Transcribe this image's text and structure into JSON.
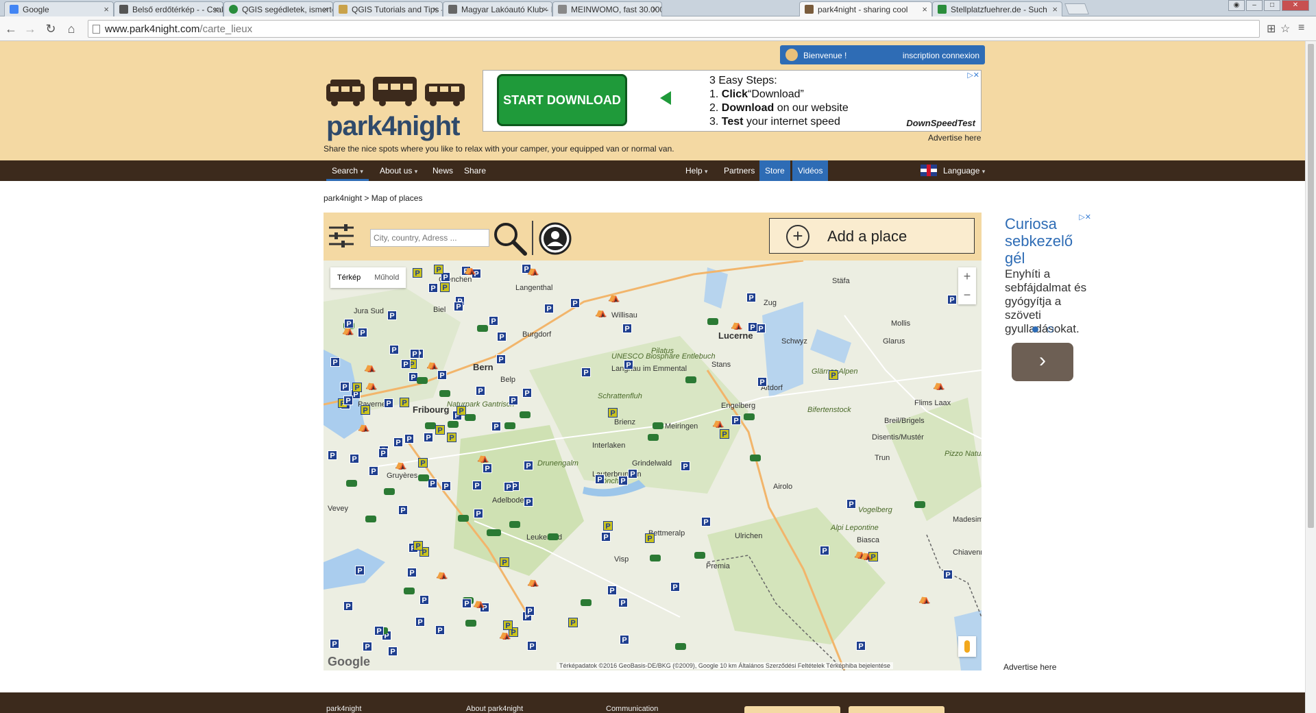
{
  "browser": {
    "tabs": [
      {
        "title": "Google",
        "color": "#4285f4"
      },
      {
        "title": "Belső erdőtérkép - - Csak",
        "color": "#555555"
      },
      {
        "title": "QGIS segédletek, ismertet",
        "color": "#2a8d3c"
      },
      {
        "title": "QGIS Tutorials and Tips —",
        "color": "#c9a24a"
      },
      {
        "title": "Magyar Lakóautó Klub - M",
        "color": "#666666"
      },
      {
        "title": "MEINWOMO, fast 30.000",
        "color": "#888888"
      },
      {
        "title": "park4night - sharing cool",
        "color": "#7a5c3c"
      },
      {
        "title": "Stellplatzfuehrer.de - Such",
        "color": "#2a8d3c"
      }
    ],
    "active_tab": 6,
    "url_host": "www.park4night.com",
    "url_path": "/carte_lieux"
  },
  "header": {
    "welcome": "Bienvenue !",
    "auth": "inscription connexion",
    "logo_text": "park4night",
    "tagline": "Share the nice spots where you like to relax with your camper, your equipped van or normal van.",
    "advertise": "Advertise here"
  },
  "ad_banner": {
    "button": "START DOWNLOAD",
    "steps_title": "3 Easy Steps:",
    "step1_bold": "Click",
    "step1_rest": "“Download”",
    "step2_bold": "Download",
    "step2_rest": "on our website",
    "step3_bold": "Test",
    "step3_rest": "your internet speed",
    "sponsor": "DownSpeedTest"
  },
  "nav": {
    "search": "Search",
    "about": "About us",
    "news": "News",
    "share": "Share",
    "help": "Help",
    "partners": "Partners",
    "store": "Store",
    "videos": "Vidéos",
    "language": "Language"
  },
  "breadcrumb": {
    "home": "park4night",
    "sep": ">",
    "current": "Map of places"
  },
  "search_panel": {
    "placeholder": "City, country, Adress ...",
    "add_place": "Add a place"
  },
  "map": {
    "type_map": "Térkép",
    "type_sat": "Műhold",
    "zoom_in": "+",
    "zoom_out": "−",
    "attribution": "Térképadatok ©2016 GeoBasis-DE/BKG (©2009), Google    10 km    Általános Szerződési Feltételek    Térképhiba bejelentése",
    "google": "Google",
    "labels": [
      {
        "text": "Grenchen"
      },
      {
        "text": "Langenthal"
      },
      {
        "text": "Biel"
      },
      {
        "text": "Willisau"
      },
      {
        "text": "Burgdorf"
      },
      {
        "text": "Bern"
      },
      {
        "text": "Fribourg"
      },
      {
        "text": "Payerne"
      },
      {
        "text": "Zug"
      },
      {
        "text": "Stäfa"
      },
      {
        "text": "Glarus"
      },
      {
        "text": "Mollis"
      },
      {
        "text": "Stans"
      },
      {
        "text": "Altdorf"
      },
      {
        "text": "Engelberg"
      },
      {
        "text": "Meiringen"
      },
      {
        "text": "Brienz"
      },
      {
        "text": "Interlaken"
      },
      {
        "text": "Grindelwald"
      },
      {
        "text": "Lauterbrunnen"
      },
      {
        "text": "Adelboden"
      },
      {
        "text": "Gruyères"
      },
      {
        "text": "Vevey"
      },
      {
        "text": "Leukerbad"
      },
      {
        "text": "Visp"
      },
      {
        "text": "Bettmeralp"
      },
      {
        "text": "Airolo"
      },
      {
        "text": "Biasca"
      },
      {
        "text": "Disentis/Mustér"
      },
      {
        "text": "Trun"
      },
      {
        "text": "Breil/Brigels"
      },
      {
        "text": "Flims Laax"
      },
      {
        "text": "Madesimo"
      },
      {
        "text": "Chiavenna"
      },
      {
        "text": "Premia"
      },
      {
        "text": "Ulrichen"
      },
      {
        "text": "Lucerne"
      },
      {
        "text": "Schwyz"
      },
      {
        "text": "Langnau im Emmental"
      },
      {
        "text": "Belp"
      },
      {
        "text": "UNESCO Biosphäre Entlebuch"
      },
      {
        "text": "Pilatus"
      },
      {
        "text": "Schrattenfluh"
      },
      {
        "text": "Naturpark Gantrisch"
      },
      {
        "text": "Drunengalm"
      },
      {
        "text": "Mönch"
      },
      {
        "text": "Glärner Alpen"
      },
      {
        "text": "Bifertenstock"
      },
      {
        "text": "Alpi Lepontine"
      },
      {
        "text": "Vogelberg"
      },
      {
        "text": "Pizzo Naturpark Beverin"
      },
      {
        "text": "Jura Sud"
      }
    ]
  },
  "right_ad": {
    "title": "Curiosa sebkezelő gél",
    "body": "Enyhíti a sebfájdalmat és gyógyítja a szöveti gyulladásokat.",
    "next": "›",
    "advertise": "Advertise here"
  },
  "footer": {
    "col1": "park4night",
    "col2": "About park4night",
    "col3": "Communication"
  },
  "colors": {
    "header_bg": "#f4d9a3",
    "nav_bg": "#3c2a1c",
    "accent": "#2e6cb5"
  }
}
